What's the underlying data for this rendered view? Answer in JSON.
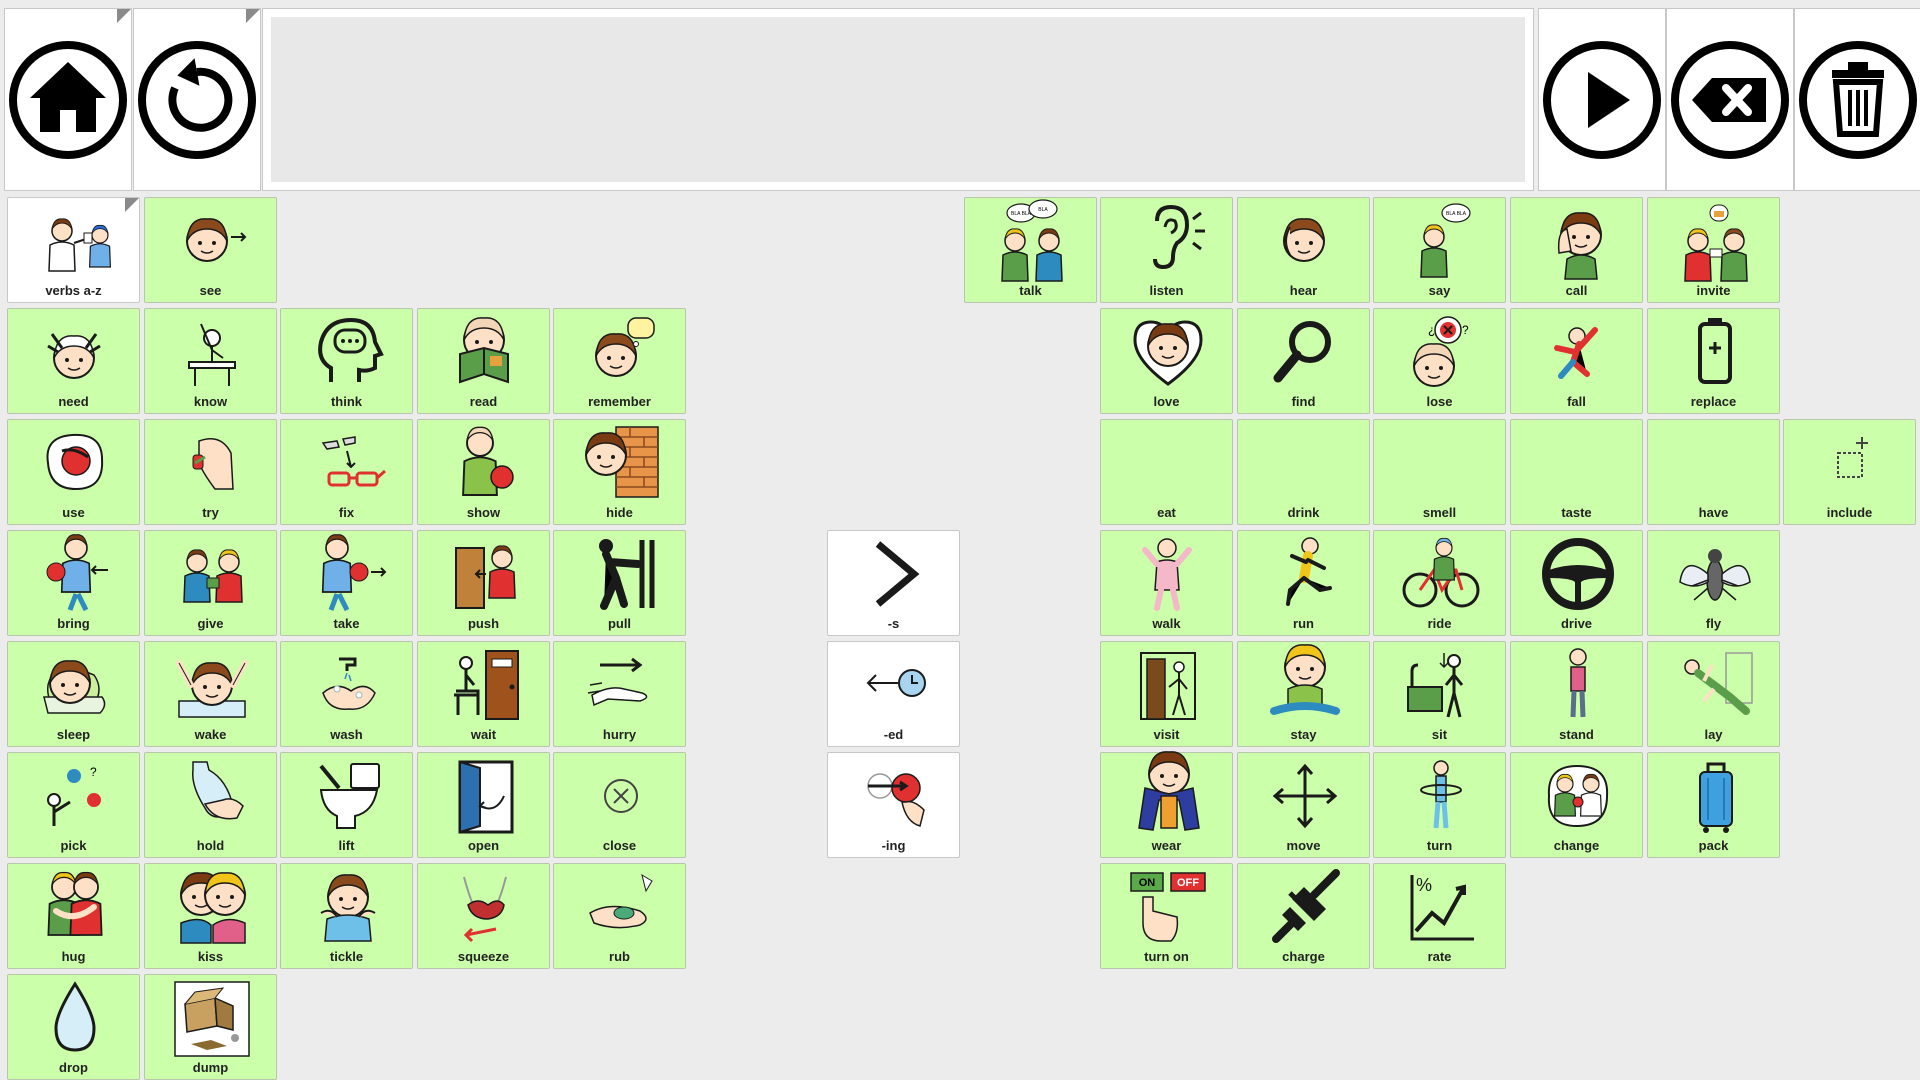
{
  "toolbar": {
    "home_icon": "home-icon",
    "undo_icon": "undo-icon",
    "speak_icon": "play-icon",
    "backspace_icon": "backspace-icon",
    "clear_icon": "trash-icon"
  },
  "message_bar": {
    "text": ""
  },
  "colors": {
    "cell": "#ccffaa",
    "white_cell": "#ffffff",
    "background": "#ececec"
  },
  "cells": [
    {
      "label": "verbs a-z",
      "icon": "verbs-icon"
    },
    {
      "label": "see",
      "icon": "see-icon"
    },
    {
      "label": "talk",
      "icon": "talk-icon"
    },
    {
      "label": "listen",
      "icon": "ear-icon"
    },
    {
      "label": "hear",
      "icon": "hear-icon"
    },
    {
      "label": "say",
      "icon": "say-icon"
    },
    {
      "label": "call",
      "icon": "call-icon"
    },
    {
      "label": "invite",
      "icon": "invite-icon"
    },
    {
      "label": "need",
      "icon": "need-icon"
    },
    {
      "label": "know",
      "icon": "know-icon"
    },
    {
      "label": "think",
      "icon": "think-icon"
    },
    {
      "label": "read",
      "icon": "read-icon"
    },
    {
      "label": "remember",
      "icon": "remember-icon"
    },
    {
      "label": "love",
      "icon": "heart-icon"
    },
    {
      "label": "find",
      "icon": "magnifier-icon"
    },
    {
      "label": "lose",
      "icon": "lose-icon"
    },
    {
      "label": "fall",
      "icon": "fall-icon"
    },
    {
      "label": "replace",
      "icon": "battery-icon"
    },
    {
      "label": "use",
      "icon": "use-icon"
    },
    {
      "label": "try",
      "icon": "try-icon"
    },
    {
      "label": "fix",
      "icon": "glasses-icon"
    },
    {
      "label": "show",
      "icon": "show-icon"
    },
    {
      "label": "hide",
      "icon": "hide-icon"
    },
    {
      "label": "eat",
      "icon": "eat-icon"
    },
    {
      "label": "drink",
      "icon": "drink-icon"
    },
    {
      "label": "smell",
      "icon": "smell-icon"
    },
    {
      "label": "taste",
      "icon": "taste-icon"
    },
    {
      "label": "have",
      "icon": "have-icon"
    },
    {
      "label": "include",
      "icon": "include-icon"
    },
    {
      "label": "bring",
      "icon": "bring-icon"
    },
    {
      "label": "give",
      "icon": "give-icon"
    },
    {
      "label": "take",
      "icon": "take-icon"
    },
    {
      "label": "push",
      "icon": "push-icon"
    },
    {
      "label": "pull",
      "icon": "pull-icon"
    },
    {
      "label": "-s",
      "icon": "chevron-right-icon"
    },
    {
      "label": "walk",
      "icon": "walk-icon"
    },
    {
      "label": "run",
      "icon": "run-icon"
    },
    {
      "label": "ride",
      "icon": "bicycle-icon"
    },
    {
      "label": "drive",
      "icon": "steering-wheel-icon"
    },
    {
      "label": "fly",
      "icon": "fly-icon"
    },
    {
      "label": "sleep",
      "icon": "sleep-icon"
    },
    {
      "label": "wake",
      "icon": "wake-icon"
    },
    {
      "label": "wash",
      "icon": "wash-icon"
    },
    {
      "label": "wait",
      "icon": "wait-icon"
    },
    {
      "label": "hurry",
      "icon": "hurry-icon"
    },
    {
      "label": "-ed",
      "icon": "past-clock-icon"
    },
    {
      "label": "visit",
      "icon": "visit-icon"
    },
    {
      "label": "stay",
      "icon": "stay-icon"
    },
    {
      "label": "sit",
      "icon": "sit-icon"
    },
    {
      "label": "stand",
      "icon": "stand-icon"
    },
    {
      "label": "lay",
      "icon": "lay-icon"
    },
    {
      "label": "pick",
      "icon": "pick-icon"
    },
    {
      "label": "hold",
      "icon": "hold-icon"
    },
    {
      "label": "lift",
      "icon": "toilet-icon"
    },
    {
      "label": "open",
      "icon": "open-door-icon"
    },
    {
      "label": "close",
      "icon": "close-circle-icon"
    },
    {
      "label": "-ing",
      "icon": "ongoing-icon"
    },
    {
      "label": "wear",
      "icon": "wear-icon"
    },
    {
      "label": "move",
      "icon": "move-arrows-icon"
    },
    {
      "label": "turn",
      "icon": "turn-icon"
    },
    {
      "label": "change",
      "icon": "change-icon"
    },
    {
      "label": "pack",
      "icon": "suitcase-icon"
    },
    {
      "label": "hug",
      "icon": "hug-icon"
    },
    {
      "label": "kiss",
      "icon": "kiss-icon"
    },
    {
      "label": "tickle",
      "icon": "tickle-icon"
    },
    {
      "label": "squeeze",
      "icon": "squeeze-icon"
    },
    {
      "label": "rub",
      "icon": "rub-icon"
    },
    {
      "label": "turn on",
      "icon": "on-off-switch-icon"
    },
    {
      "label": "charge",
      "icon": "plug-icon"
    },
    {
      "label": "rate",
      "icon": "rate-chart-icon"
    },
    {
      "label": "drop",
      "icon": "water-drop-icon"
    },
    {
      "label": "dump",
      "icon": "dump-icon"
    }
  ]
}
